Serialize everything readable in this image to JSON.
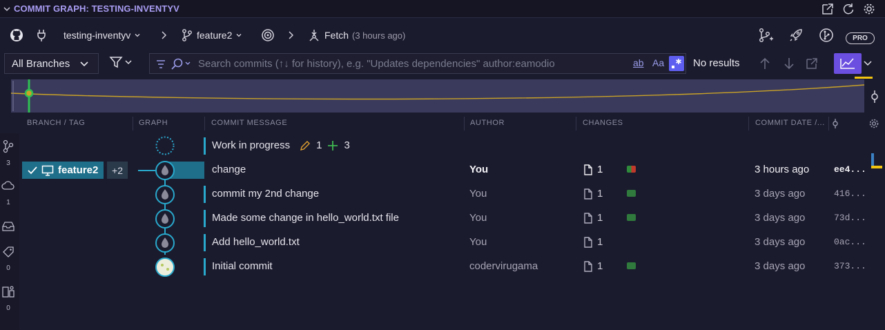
{
  "titlebar": {
    "title": "COMMIT GRAPH: TESTING-INVENTYV"
  },
  "toolbar": {
    "repo": "testing-inventyv",
    "branch": "feature2",
    "fetch_label": "Fetch",
    "fetch_time": "(3 hours ago)",
    "pro_badge": "PRO"
  },
  "search": {
    "branches_filter": "All Branches",
    "placeholder": "Search commits (↑↓ for history), e.g. \"Updates dependencies\" author:eamodio",
    "match_word": "ab",
    "match_case": "Aa",
    "results": "No results"
  },
  "columns": {
    "branch_tag": "BRANCH / TAG",
    "graph": "GRAPH",
    "message": "COMMIT MESSAGE",
    "author": "AUTHOR",
    "changes": "CHANGES",
    "date": "COMMIT DATE /..."
  },
  "sidebar": {
    "branches_count": "3",
    "remotes_count": "1",
    "tags_count": "0",
    "worktrees_count": "0"
  },
  "wip": {
    "message": "Work in progress",
    "modified": "1",
    "added": "3"
  },
  "branch_chip": {
    "label": "feature2",
    "more": "+2"
  },
  "commits": [
    {
      "message": "change",
      "author": "You",
      "files": "1",
      "date": "3 hours ago",
      "sha": "ee4...",
      "bar": "mixed"
    },
    {
      "message": "commit my 2nd change",
      "author": "You",
      "files": "1",
      "date": "3 days ago",
      "sha": "416...",
      "bar": "green"
    },
    {
      "message": "Made some change in hello_world.txt file",
      "author": "You",
      "files": "1",
      "date": "3 days ago",
      "sha": "73d...",
      "bar": "green"
    },
    {
      "message": "Add hello_world.txt",
      "author": "You",
      "files": "1",
      "date": "3 days ago",
      "sha": "0ac...",
      "bar": "none"
    },
    {
      "message": "Initial commit",
      "author": "codervirugama",
      "files": "1",
      "date": "3 days ago",
      "sha": "373...",
      "bar": "green"
    }
  ],
  "colors": {
    "accent": "#a99cf2",
    "lane": "#29a9cc",
    "branch_chip": "#1f6f8a",
    "added": "#2f8a3c",
    "deleted": "#c0392b",
    "active_toggle": "#6b4fe0"
  }
}
